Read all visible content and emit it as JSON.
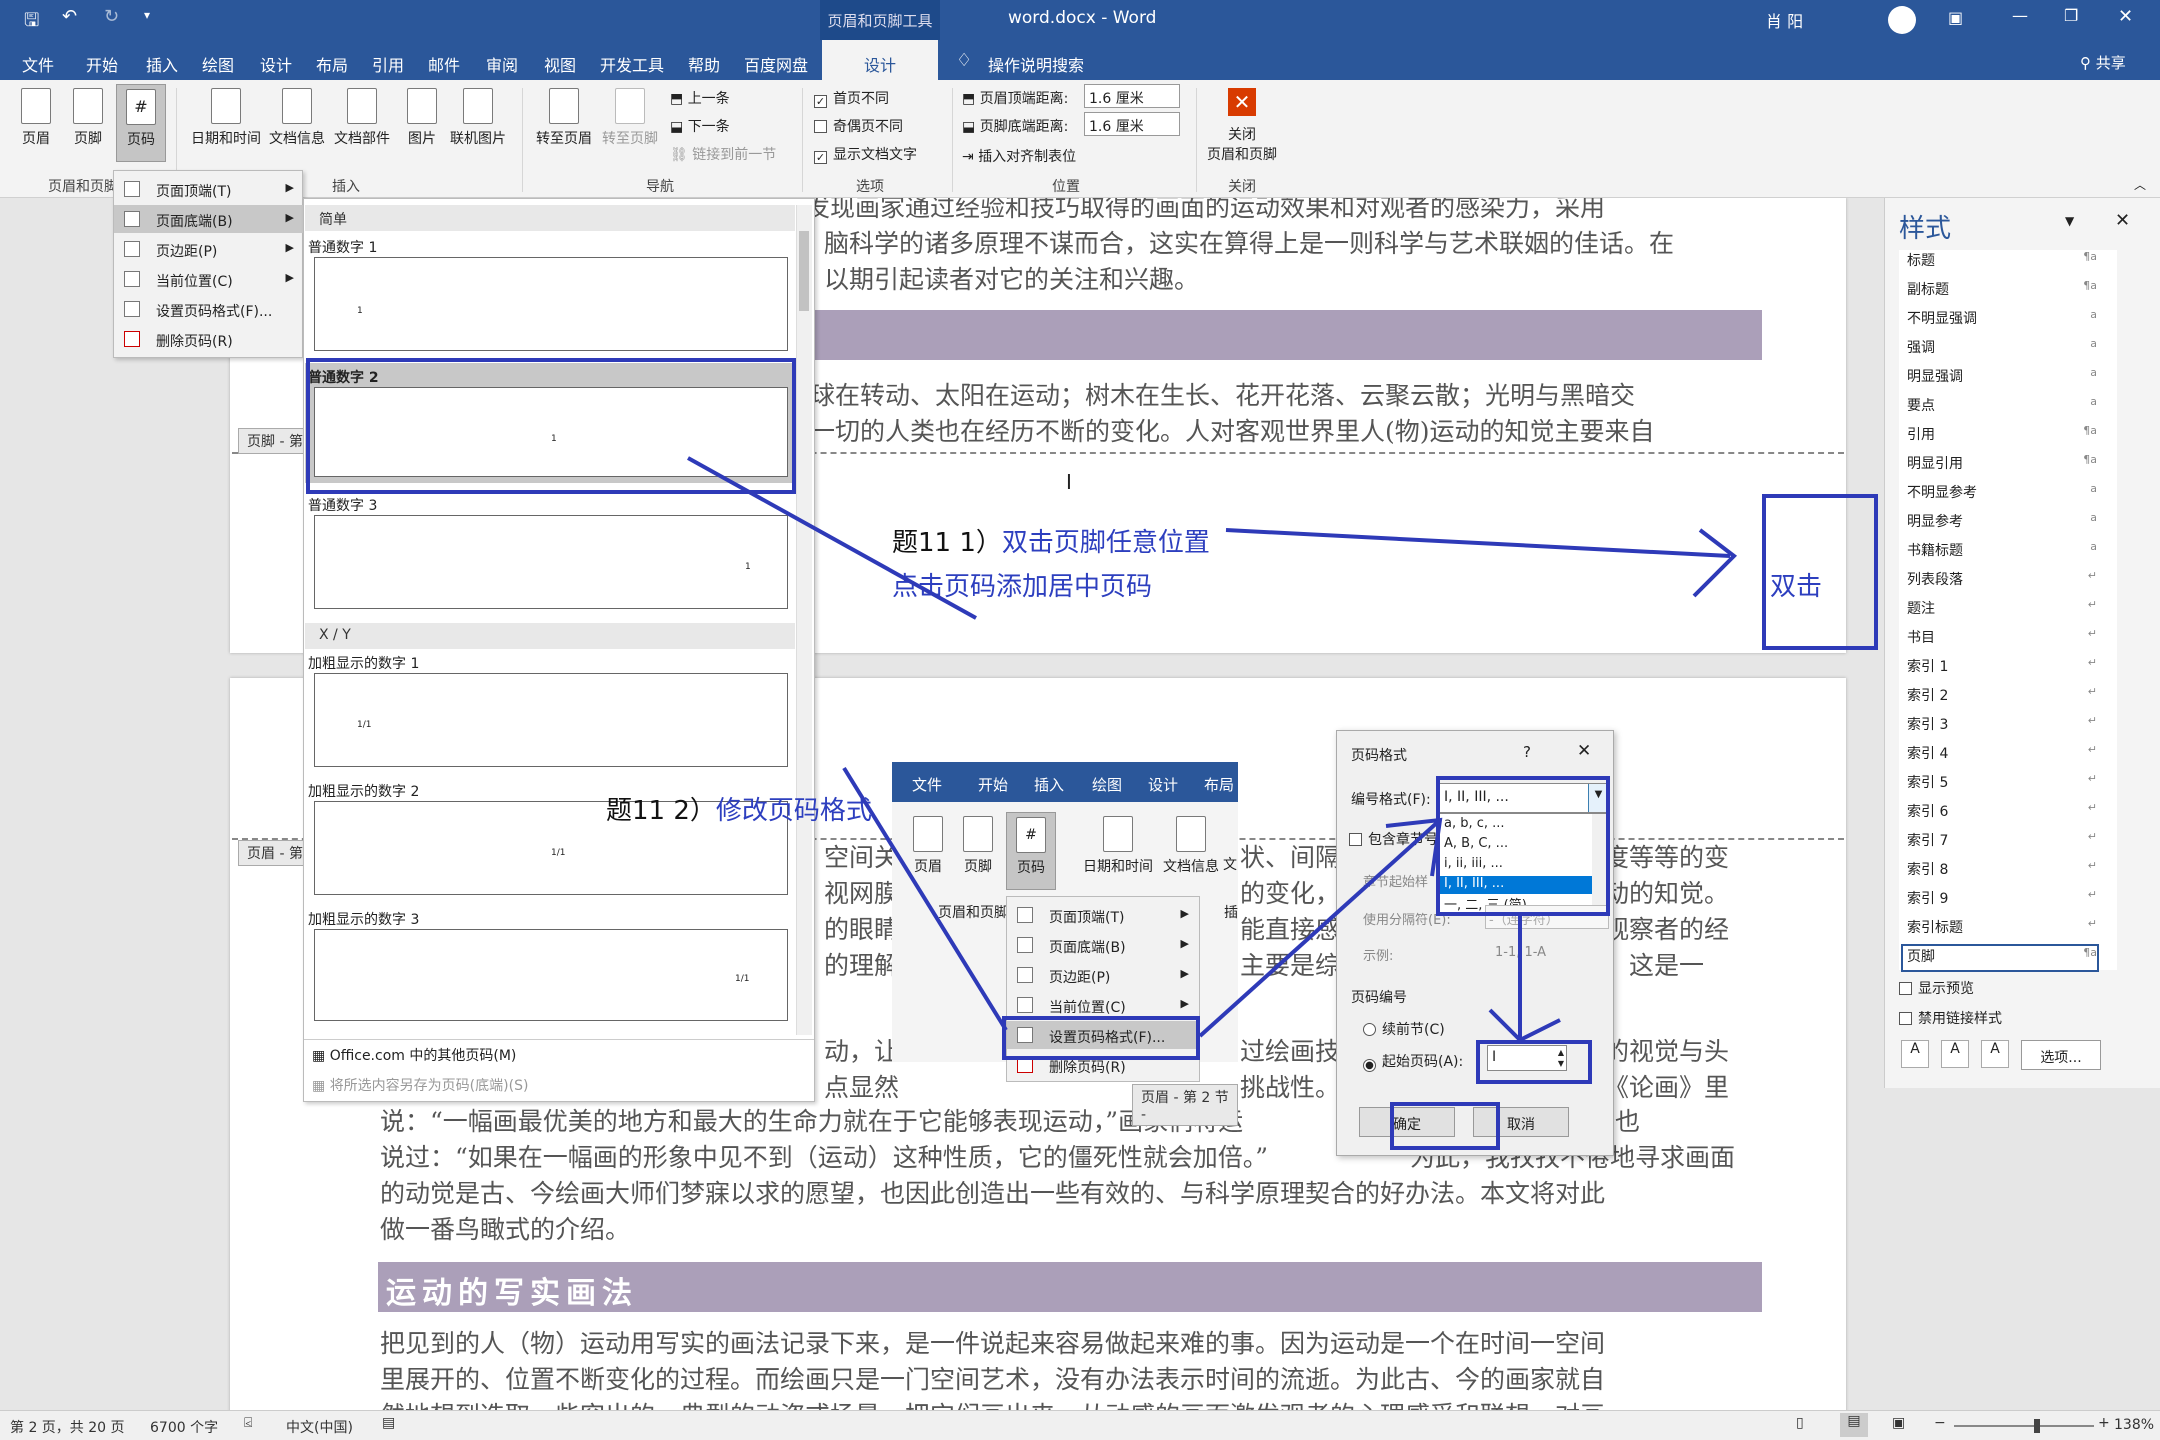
{
  "titlebar": {
    "context_tool": "页眉和页脚工具",
    "doc_title": "word.docx  -  Word",
    "user": "肖 阳",
    "min": "—",
    "restore": "❐",
    "close": "✕"
  },
  "menubar": {
    "tabs": [
      "文件",
      "开始",
      "插入",
      "绘图",
      "设计",
      "布局",
      "引用",
      "邮件",
      "审阅",
      "视图",
      "开发工具",
      "帮助",
      "百度网盘",
      "设计"
    ],
    "search": "操作说明搜索",
    "share": "共享"
  },
  "ribbon": {
    "group1": {
      "buttons": [
        "页眉",
        "页脚",
        "页码"
      ],
      "label": "页眉和页脚"
    },
    "group2": {
      "buttons": [
        "日期和时间",
        "文档信息",
        "文档部件",
        "图片",
        "联机图片"
      ],
      "label": "插入"
    },
    "group3": {
      "buttons": [
        "转至页眉",
        "转至页脚"
      ],
      "small": [
        "上一条",
        "下一条",
        "链接到前一节"
      ],
      "label": "导航"
    },
    "group4": {
      "checks": [
        "首页不同",
        "奇偶页不同",
        "显示文档文字"
      ],
      "label": "选项"
    },
    "group5": {
      "header_dist_label": "页眉顶端距离:",
      "header_dist": "1.6 厘米",
      "footer_dist_label": "页脚底端距离:",
      "footer_dist": "1.6 厘米",
      "align_tab": "插入对齐制表位",
      "label": "位置"
    },
    "group6": {
      "close_label1": "关闭",
      "close_label2": "页眉和页脚",
      "label": "关闭"
    }
  },
  "page_number_menu": {
    "items": [
      "页面顶端(T)",
      "页面底端(B)",
      "页边距(P)",
      "当前位置(C)",
      "设置页码格式(F)...",
      "删除页码(R)"
    ]
  },
  "gallery": {
    "section1": "简单",
    "items": [
      "普通数字 1",
      "普通数字 2",
      "普通数字 3"
    ],
    "section2": "X / Y",
    "bold_items": [
      "加粗显示的数字 1",
      "加粗显示的数字 2",
      "加粗显示的数字 3"
    ],
    "thumb_marks": [
      "1",
      "1",
      "1",
      "1/1",
      "1/1",
      "1/1"
    ],
    "more": "Office.com 中的其他页码(M)",
    "save": "将所选内容另存为页码(底端)(S)"
  },
  "document": {
    "lines_top": [
      "些有趣的事中来说，近些年来科学家们发现画家通过经验和技巧取得的画面的运动效果和对观者的感染力，采用",
      "脑科学的诸多原理不谋而合，这实在算得上是一则科学与艺术联姻的佳话。在",
      "以期引起读者对它的关注和兴趣。"
    ],
    "lines_mid": [
      "球在转动、太阳在运动；树木在生长、花开花落、云聚云散；光明与黑暗交",
      "一切的人类也在经历不断的变化。人对客观世界里人(物)运动的知觉主要来自"
    ],
    "footer_label": "页脚 - 第",
    "header_label": "页眉 - 第",
    "lines_lower": [
      "说：“一幅画最优美的地方和最大的生命力就在于它能够表现运动，”画家们将运",
      "达芬奇也",
      "说过：“如果在一幅画的形象中见不到（运动）这种性质，它的僵死性就会加倍。”",
      "为此，我孜孜不倦地寻求画面",
      "的动觉是古、今绘画大师们梦寐以求的愿望，也因此创造出一些有效的、与科学原理契合的好办法。本文将对此",
      "做一番鸟瞰式的介绍。"
    ],
    "heading2": "运动的写实画法",
    "lines_bottom": [
      "把见到的人（物）运动用写实的画法记录下来，是一件说起来容易做起来难的事。因为运动是一个在时间一空间",
      "里展开的、位置不断变化的过程。而绘画只是一门空间艺术，没有办法表示时间的流逝。为此古、今的画家就自",
      "然地想到选取一些突出的、典型的动姿或场景，把它们画出来，从动感的画面激发观者的心理感受和联想，对画"
    ],
    "frag_right": [
      "状、间隔",
      "的变化，",
      "能直接感",
      "主要是综",
      "过绘画技",
      "挑战性。"
    ],
    "frag_right2": [
      "度等等的变",
      "动的知觉。",
      "观察者的经",
      "，这是一",
      "的视觉与头",
      "《论画》里"
    ],
    "frag_left": [
      "空间关",
      "视网膜",
      "的眼睛",
      "的理解",
      "动，让",
      "点显然"
    ]
  },
  "annotations": {
    "q1_prefix": "题11 1）",
    "q1_text": "双击页脚任意位置",
    "q1_text2": "点击页码添加居中页码",
    "dbl": "双击",
    "q2_prefix": "题11 2）",
    "q2_text": "修改页码格式"
  },
  "inset": {
    "tabs": [
      "文件",
      "开始",
      "插入",
      "绘图",
      "设计",
      "布局"
    ],
    "buttons": [
      "页眉",
      "页脚",
      "页码",
      "日期和时间",
      "文档信息",
      "文"
    ],
    "group": "页眉和页脚",
    "group2": "插",
    "menu": [
      "页面顶端(T)",
      "页面底端(B)",
      "页边距(P)",
      "当前位置(C)",
      "设置页码格式(F)...",
      "删除页码(R)"
    ],
    "footer_label": "页眉 - 第 2 节 -"
  },
  "page_format_dialog": {
    "title": "页码格式",
    "help": "?",
    "close": "✕",
    "format_label": "编号格式(F):",
    "format_value": "I, II, III, ...",
    "options": [
      "a, b, c, ...",
      "A, B, C, ...",
      "i, ii, iii, ...",
      "I, II, III, ...",
      "一, 二, 三 (简)..."
    ],
    "include_chapter": "包含章节号",
    "chapter_start": "章节起始样",
    "separator": "使用分隔符(E):",
    "separator_value": "-（连字符）",
    "example_label": "示例:",
    "example_value": "1-1, 1-A",
    "numbering": "页码编号",
    "continue": "续前节(C)",
    "start_at": "起始页码(A):",
    "start_value": "I",
    "ok": "确定",
    "cancel": "取消"
  },
  "styles_pane": {
    "title": "样式",
    "items": [
      "标题",
      "副标题",
      "不明显强调",
      "强调",
      "明显强调",
      "要点",
      "引用",
      "明显引用",
      "不明显参考",
      "明显参考",
      "书籍标题",
      "列表段落",
      "题注",
      "书目",
      "索引 1",
      "索引 2",
      "索引 3",
      "索引 4",
      "索引 5",
      "索引 6",
      "索引 7",
      "索引 8",
      "索引 9",
      "索引标题",
      "页脚"
    ],
    "glyphs": [
      "¶a",
      "¶a",
      "a",
      "a",
      "a",
      "a",
      "¶a",
      "¶a",
      "a",
      "a",
      "a",
      "↵",
      "↵",
      "↵",
      "↵",
      "↵",
      "↵",
      "↵",
      "↵",
      "↵",
      "↵",
      "↵",
      "↵",
      "↵",
      "¶a"
    ],
    "show_preview": "显示预览",
    "disable_linked": "禁用链接样式",
    "options": "选项..."
  },
  "statusbar": {
    "page": "第 2 页，共 20 页",
    "words": "6700 个字",
    "lang": "中文(中国)",
    "zoom": "138%"
  }
}
